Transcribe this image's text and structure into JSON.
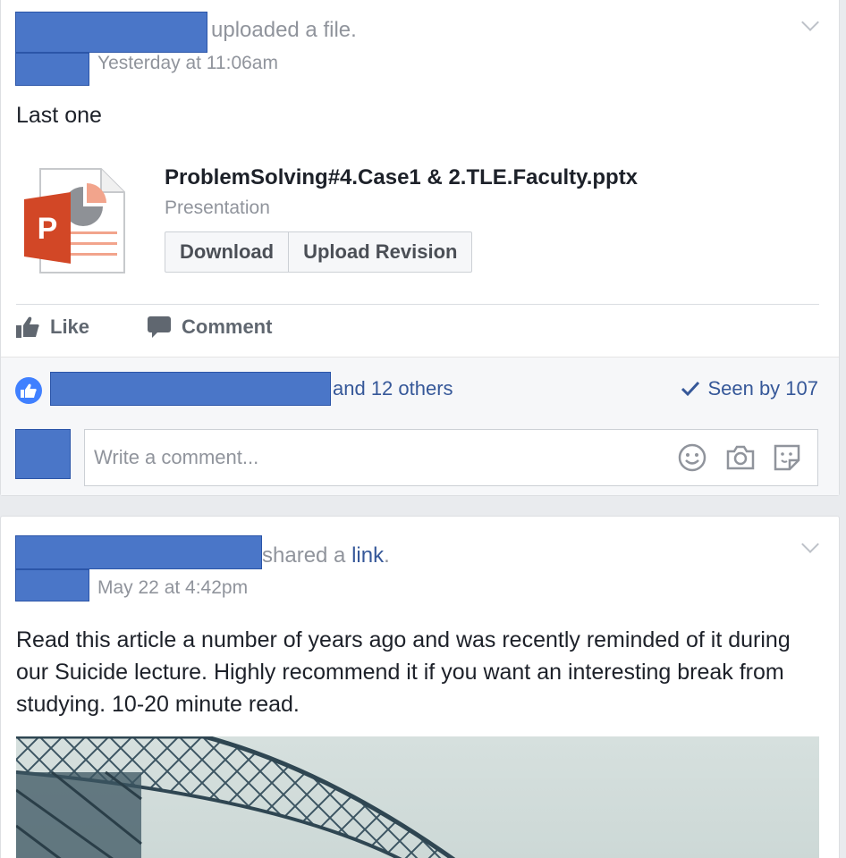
{
  "post1": {
    "header_action": "uploaded a file.",
    "timestamp": "Yesterday at 11:06am",
    "message": "Last one",
    "attachment": {
      "file_name": "ProblemSolving#4.Case1 & 2.TLE.Faculty.pptx",
      "file_type": "Presentation",
      "icon_letter": "P",
      "download_label": "Download",
      "upload_revision_label": "Upload Revision"
    },
    "actions": {
      "like_label": "Like",
      "comment_label": "Comment"
    },
    "likes_text": "and 12 others",
    "seen_text": "Seen by 107",
    "comment_placeholder": "Write a comment..."
  },
  "post2": {
    "header_action_prefix": "shared a ",
    "header_action_link": "link",
    "header_action_suffix": ".",
    "timestamp": "May 22 at 4:42pm",
    "message": "Read this article a number of years ago and was recently reminded of it during our Suicide lecture. Highly recommend it if you want an interesting break from studying. 10-20 minute read."
  },
  "colors": {
    "facebook_blue": "#4080ff",
    "link_blue": "#365899",
    "ppt_orange": "#d24726",
    "redaction_blue": "#4a76c8"
  },
  "icons": [
    "chevron-down-icon",
    "powerpoint-file-icon",
    "thumbs-up-icon",
    "comment-bubble-icon",
    "like-reaction-icon",
    "checkmark-icon",
    "emoji-icon",
    "camera-icon",
    "sticker-icon"
  ]
}
